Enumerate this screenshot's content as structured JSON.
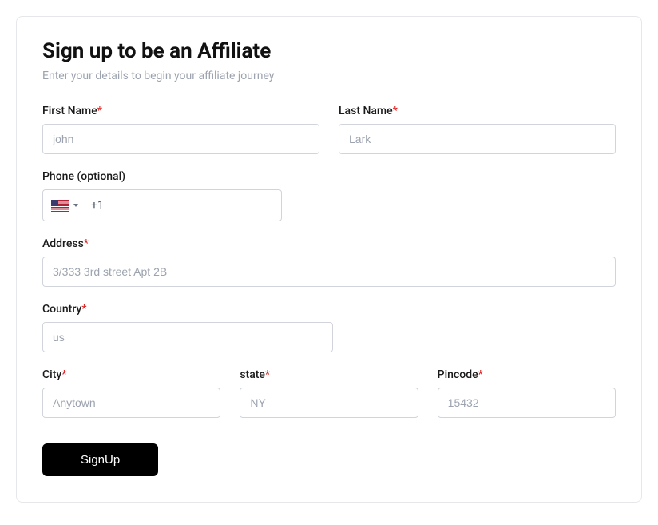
{
  "header": {
    "title": "Sign up to be an Affiliate",
    "subtitle": "Enter your details to begin your affiliate journey"
  },
  "labels": {
    "first_name": "First Name",
    "last_name": "Last Name",
    "phone": "Phone (optional)",
    "address": "Address",
    "country": "Country",
    "city": "City",
    "state": "state",
    "pincode": "Pincode"
  },
  "asterisk": "*",
  "placeholders": {
    "first_name": "john",
    "last_name": "Lark",
    "address": "3/333 3rd street Apt 2B",
    "country": "us",
    "city": "Anytown",
    "state": "NY",
    "pincode": "15432"
  },
  "phone": {
    "dial_code": "+1",
    "country_code": "US"
  },
  "values": {
    "first_name": "",
    "last_name": "",
    "phone": "",
    "address": "",
    "country": "",
    "city": "",
    "state": "",
    "pincode": ""
  },
  "button": {
    "submit": "SignUp"
  }
}
